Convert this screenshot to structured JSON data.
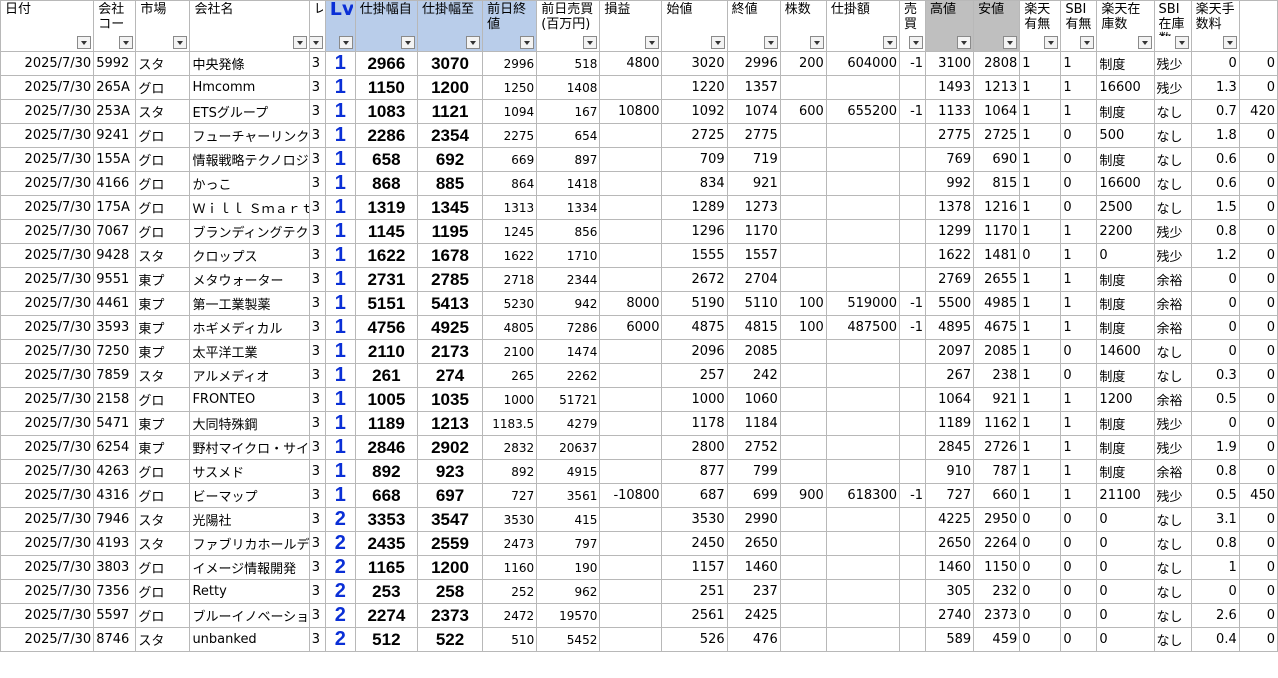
{
  "headers": [
    "日付",
    "会社コード",
    "市場",
    "会社名",
    "レ",
    "Lv",
    "仕掛幅自",
    "仕掛幅至",
    "前日終値",
    "前日売買(百万円)",
    "損益",
    "始値",
    "終値",
    "株数",
    "仕掛額",
    "売買",
    "高値",
    "安値",
    "楽天有無",
    "SBI有無",
    "楽天在庫数",
    "SBI在庫数",
    "楽天手数料",
    ""
  ],
  "header_display": [
    "日付",
    "会社コー",
    "市場",
    "会社名",
    "レ",
    "Lv",
    "仕掛幅自",
    "仕掛幅至",
    "前日終値",
    "前日売買(百万円)",
    "損益",
    "始値",
    "終値",
    "株数",
    "仕掛額",
    "売買",
    "高値",
    "安値",
    "楽天有無",
    "SBI有無",
    "楽天在庫数",
    "SBI在庫数",
    "楽天手数料",
    ""
  ],
  "rows": [
    [
      "2025/7/30",
      "5992",
      "スタ",
      "中央発條",
      "3",
      "1",
      "2966",
      "3070",
      "2996",
      "518",
      "4800",
      "3020",
      "2996",
      "200",
      "604000",
      "-1",
      "3100",
      "2808",
      "1",
      "1",
      "制度",
      "残少",
      "0",
      "0"
    ],
    [
      "2025/7/30",
      "265A",
      "グロ",
      "Hmcomm",
      "3",
      "1",
      "1150",
      "1200",
      "1250",
      "1408",
      "",
      "1220",
      "1357",
      "",
      "",
      "",
      "1493",
      "1213",
      "1",
      "1",
      "16600",
      "残少",
      "1.3",
      "0"
    ],
    [
      "2025/7/30",
      "253A",
      "スタ",
      "ETSグループ",
      "3",
      "1",
      "1083",
      "1121",
      "1094",
      "167",
      "10800",
      "1092",
      "1074",
      "600",
      "655200",
      "-1",
      "1133",
      "1064",
      "1",
      "1",
      "制度",
      "なし",
      "0.7",
      "420"
    ],
    [
      "2025/7/30",
      "9241",
      "グロ",
      "フューチャーリンクネットワーク",
      "3",
      "1",
      "2286",
      "2354",
      "2275",
      "654",
      "",
      "2725",
      "2775",
      "",
      "",
      "",
      "2775",
      "2725",
      "1",
      "0",
      "500",
      "なし",
      "1.8",
      "0"
    ],
    [
      "2025/7/30",
      "155A",
      "グロ",
      "情報戦略テクノロジー",
      "3",
      "1",
      "658",
      "692",
      "669",
      "897",
      "",
      "709",
      "719",
      "",
      "",
      "",
      "769",
      "690",
      "1",
      "0",
      "制度",
      "なし",
      "0.6",
      "0"
    ],
    [
      "2025/7/30",
      "4166",
      "グロ",
      "かっこ",
      "3",
      "1",
      "868",
      "885",
      "864",
      "1418",
      "",
      "834",
      "921",
      "",
      "",
      "",
      "992",
      "815",
      "1",
      "0",
      "16600",
      "なし",
      "0.6",
      "0"
    ],
    [
      "2025/7/30",
      "175A",
      "グロ",
      "Ｗｉｌｌ Ｓｍａｒｔ",
      "3",
      "1",
      "1319",
      "1345",
      "1313",
      "1334",
      "",
      "1289",
      "1273",
      "",
      "",
      "",
      "1378",
      "1216",
      "1",
      "0",
      "2500",
      "なし",
      "1.5",
      "0"
    ],
    [
      "2025/7/30",
      "7067",
      "グロ",
      "ブランディングテクノロジー",
      "3",
      "1",
      "1145",
      "1195",
      "1245",
      "856",
      "",
      "1296",
      "1170",
      "",
      "",
      "",
      "1299",
      "1170",
      "1",
      "1",
      "2200",
      "残少",
      "0.8",
      "0"
    ],
    [
      "2025/7/30",
      "9428",
      "スタ",
      "クロップス",
      "3",
      "1",
      "1622",
      "1678",
      "1622",
      "1710",
      "",
      "1555",
      "1557",
      "",
      "",
      "",
      "1622",
      "1481",
      "0",
      "1",
      "0",
      "残少",
      "1.2",
      "0"
    ],
    [
      "2025/7/30",
      "9551",
      "東プ",
      "メタウォーター",
      "3",
      "1",
      "2731",
      "2785",
      "2718",
      "2344",
      "",
      "2672",
      "2704",
      "",
      "",
      "",
      "2769",
      "2655",
      "1",
      "1",
      "制度",
      "余裕",
      "0",
      "0"
    ],
    [
      "2025/7/30",
      "4461",
      "東プ",
      "第一工業製薬",
      "3",
      "1",
      "5151",
      "5413",
      "5230",
      "942",
      "8000",
      "5190",
      "5110",
      "100",
      "519000",
      "-1",
      "5500",
      "4985",
      "1",
      "1",
      "制度",
      "余裕",
      "0",
      "0"
    ],
    [
      "2025/7/30",
      "3593",
      "東プ",
      "ホギメディカル",
      "3",
      "1",
      "4756",
      "4925",
      "4805",
      "7286",
      "6000",
      "4875",
      "4815",
      "100",
      "487500",
      "-1",
      "4895",
      "4675",
      "1",
      "1",
      "制度",
      "余裕",
      "0",
      "0"
    ],
    [
      "2025/7/30",
      "7250",
      "東プ",
      "太平洋工業",
      "3",
      "1",
      "2110",
      "2173",
      "2100",
      "1474",
      "",
      "2096",
      "2085",
      "",
      "",
      "",
      "2097",
      "2085",
      "1",
      "0",
      "14600",
      "なし",
      "0",
      "0"
    ],
    [
      "2025/7/30",
      "7859",
      "スタ",
      "アルメディオ",
      "3",
      "1",
      "261",
      "274",
      "265",
      "2262",
      "",
      "257",
      "242",
      "",
      "",
      "",
      "267",
      "238",
      "1",
      "0",
      "制度",
      "なし",
      "0.3",
      "0"
    ],
    [
      "2025/7/30",
      "2158",
      "グロ",
      "FRONTEO",
      "3",
      "1",
      "1005",
      "1035",
      "1000",
      "51721",
      "",
      "1000",
      "1060",
      "",
      "",
      "",
      "1064",
      "921",
      "1",
      "1",
      "1200",
      "余裕",
      "0.5",
      "0"
    ],
    [
      "2025/7/30",
      "5471",
      "東プ",
      "大同特殊鋼",
      "3",
      "1",
      "1189",
      "1213",
      "1183.5",
      "4279",
      "",
      "1178",
      "1184",
      "",
      "",
      "",
      "1189",
      "1162",
      "1",
      "1",
      "制度",
      "残少",
      "0",
      "0"
    ],
    [
      "2025/7/30",
      "6254",
      "東プ",
      "野村マイクロ・サイエンス",
      "3",
      "1",
      "2846",
      "2902",
      "2832",
      "20637",
      "",
      "2800",
      "2752",
      "",
      "",
      "",
      "2845",
      "2726",
      "1",
      "1",
      "制度",
      "残少",
      "1.9",
      "0"
    ],
    [
      "2025/7/30",
      "4263",
      "グロ",
      "サスメド",
      "3",
      "1",
      "892",
      "923",
      "892",
      "4915",
      "",
      "877",
      "799",
      "",
      "",
      "",
      "910",
      "787",
      "1",
      "1",
      "制度",
      "余裕",
      "0.8",
      "0"
    ],
    [
      "2025/7/30",
      "4316",
      "グロ",
      "ビーマップ",
      "3",
      "1",
      "668",
      "697",
      "727",
      "3561",
      "-10800",
      "687",
      "699",
      "900",
      "618300",
      "-1",
      "727",
      "660",
      "1",
      "1",
      "21100",
      "残少",
      "0.5",
      "450"
    ],
    [
      "2025/7/30",
      "7946",
      "スタ",
      "光陽社",
      "3",
      "2",
      "3353",
      "3547",
      "3530",
      "415",
      "",
      "3530",
      "2990",
      "",
      "",
      "",
      "4225",
      "2950",
      "0",
      "0",
      "0",
      "なし",
      "3.1",
      "0"
    ],
    [
      "2025/7/30",
      "4193",
      "スタ",
      "ファブリカホールディングス",
      "3",
      "2",
      "2435",
      "2559",
      "2473",
      "797",
      "",
      "2450",
      "2650",
      "",
      "",
      "",
      "2650",
      "2264",
      "0",
      "0",
      "0",
      "なし",
      "0.8",
      "0"
    ],
    [
      "2025/7/30",
      "3803",
      "グロ",
      "イメージ情報開発",
      "3",
      "2",
      "1165",
      "1200",
      "1160",
      "190",
      "",
      "1157",
      "1460",
      "",
      "",
      "",
      "1460",
      "1150",
      "0",
      "0",
      "0",
      "なし",
      "1",
      "0"
    ],
    [
      "2025/7/30",
      "7356",
      "グロ",
      "Retty",
      "3",
      "2",
      "253",
      "258",
      "252",
      "962",
      "",
      "251",
      "237",
      "",
      "",
      "",
      "305",
      "232",
      "0",
      "0",
      "0",
      "なし",
      "0",
      "0"
    ],
    [
      "2025/7/30",
      "5597",
      "グロ",
      "ブルーイノベーション",
      "3",
      "2",
      "2274",
      "2373",
      "2472",
      "19570",
      "",
      "2561",
      "2425",
      "",
      "",
      "",
      "2740",
      "2373",
      "0",
      "0",
      "0",
      "なし",
      "2.6",
      "0"
    ],
    [
      "2025/7/30",
      "8746",
      "スタ",
      "unbanked",
      "3",
      "2",
      "512",
      "522",
      "510",
      "5452",
      "",
      "526",
      "476",
      "",
      "",
      "",
      "589",
      "459",
      "0",
      "0",
      "0",
      "なし",
      "0.4",
      "0"
    ]
  ],
  "colors": {
    "lv_blue": "#0a2fd6",
    "header_blue": "#b9cdea",
    "header_gray": "#bfbfbf"
  }
}
